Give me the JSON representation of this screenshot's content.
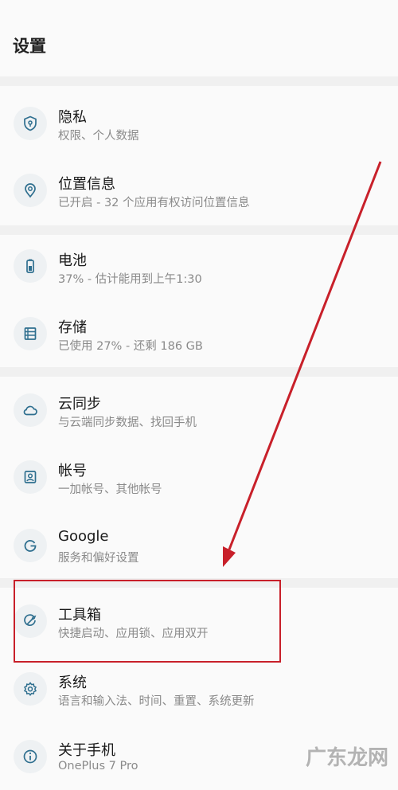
{
  "header": {
    "title": "设置"
  },
  "items": [
    {
      "id": "privacy",
      "icon": "shield-icon",
      "label": "隐私",
      "sub": "权限、个人数据"
    },
    {
      "id": "location",
      "icon": "location-pin-icon",
      "label": "位置信息",
      "sub": "已开启 - 32 个应用有权访问位置信息"
    },
    {
      "id": "battery",
      "icon": "battery-icon",
      "label": "电池",
      "sub": "37% - 估计能用到上午1:30"
    },
    {
      "id": "storage",
      "icon": "storage-icon",
      "label": "存储",
      "sub": "已使用 27% - 还剩 186 GB"
    },
    {
      "id": "cloud",
      "icon": "cloud-icon",
      "label": "云同步",
      "sub": "与云端同步数据、找回手机"
    },
    {
      "id": "accounts",
      "icon": "account-icon",
      "label": "帐号",
      "sub": "一加帐号、其他帐号"
    },
    {
      "id": "google",
      "icon": "google-icon",
      "label": "Google",
      "sub": "服务和偏好设置"
    },
    {
      "id": "toolbox",
      "icon": "toolbox-icon",
      "label": "工具箱",
      "sub": "快捷启动、应用锁、应用双开"
    },
    {
      "id": "system",
      "icon": "gear-icon",
      "label": "系统",
      "sub": "语言和输入法、时间、重置、系统更新"
    },
    {
      "id": "about",
      "icon": "info-icon",
      "label": "关于手机",
      "sub": "OnePlus 7 Pro"
    }
  ],
  "watermark": "广东龙网",
  "colors": {
    "icon": "#2f6f8f",
    "annotation": "#c8202a"
  }
}
